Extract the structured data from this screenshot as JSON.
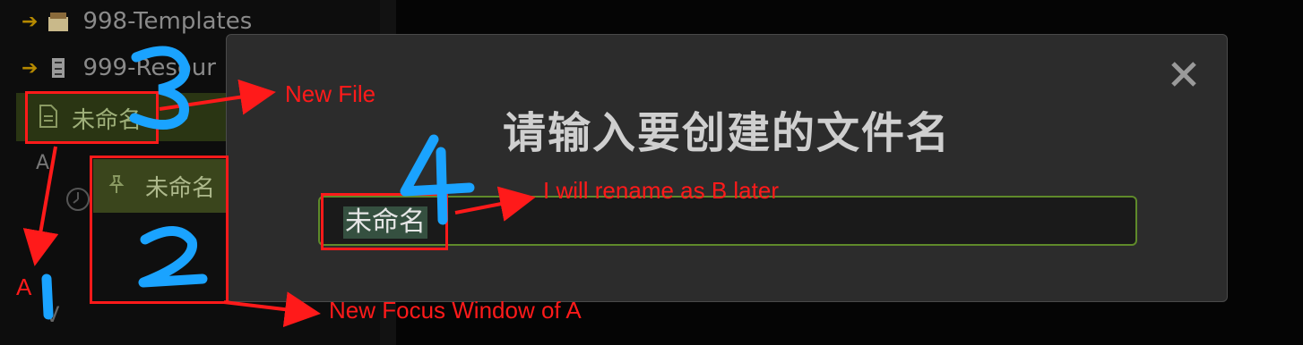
{
  "sidebar": {
    "folders": [
      {
        "name": "998-Templates",
        "icon": "folder-box-icon"
      },
      {
        "name": "999-Resour",
        "icon": "cabinet-icon"
      }
    ],
    "active_file": {
      "name": "未命名",
      "icon": "document-icon"
    },
    "partial_row_a": "A",
    "partial_row_v": "V"
  },
  "focus_window": {
    "title": "未命名",
    "icon": "pin-icon"
  },
  "modal": {
    "title": "请输入要创建的文件名",
    "input_value": "未命名",
    "close_icon": "close-icon"
  },
  "annotations": {
    "new_file": "New File",
    "rename_note": "I will rename as B later",
    "focus_window_note": "New Focus Window of A",
    "label_a": "A",
    "steps": [
      "1",
      "2",
      "3",
      "4"
    ]
  },
  "colors": {
    "annotation_red": "#ff1a1a",
    "step_blue": "#1aa3ff",
    "input_border": "#5f8a2a",
    "active_row": "#2a3513"
  }
}
